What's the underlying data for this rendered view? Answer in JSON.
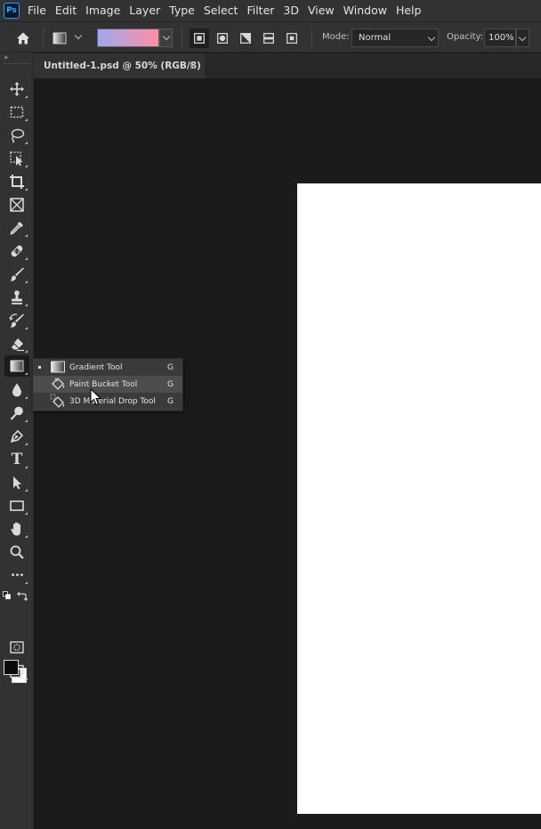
{
  "app": {
    "logo": "Ps"
  },
  "menubar": {
    "items": [
      "File",
      "Edit",
      "Image",
      "Layer",
      "Type",
      "Select",
      "Filter",
      "3D",
      "View",
      "Window",
      "Help"
    ]
  },
  "options": {
    "mode_label": "Mode:",
    "mode_value": "Normal",
    "opacity_label": "Opacity:",
    "opacity_value": "100%",
    "gradient_colors": [
      "#9fa8ee",
      "#fd8fa4"
    ],
    "gradient_types": [
      "linear-gradient-icon",
      "radial-gradient-icon",
      "angle-gradient-icon",
      "reflected-gradient-icon",
      "diamond-gradient-icon"
    ]
  },
  "document": {
    "tab_title": "Untitled-1.psd @ 50% (RGB/8)",
    "close_glyph": "×",
    "canvas_color": "#ffffff"
  },
  "toolbar": {
    "collapse_glyph": "»",
    "tools": [
      "move-tool",
      "marquee-tool",
      "lasso-tool",
      "object-selection-tool",
      "crop-tool",
      "frame-tool",
      "eyedropper-tool",
      "healing-brush-tool",
      "brush-tool",
      "clone-stamp-tool",
      "history-brush-tool",
      "eraser-tool",
      "gradient-tool",
      "blur-tool",
      "dodge-tool",
      "pen-tool",
      "type-tool",
      "path-selection-tool",
      "rectangle-tool",
      "hand-tool",
      "zoom-tool",
      "edit-toolbar",
      "default-colors",
      "swap-colors",
      "quick-mask",
      "screen-mode"
    ],
    "type_glyph": "T",
    "more_glyph": "•••",
    "foreground_color": "#0a0a0a",
    "background_color": "#ffffff"
  },
  "flyout": {
    "items": [
      {
        "label": "Gradient Tool",
        "shortcut": "G",
        "selected": true
      },
      {
        "label": "Paint Bucket Tool",
        "shortcut": "G",
        "hovered": true
      },
      {
        "label": "3D Material Drop Tool",
        "shortcut": "G"
      }
    ]
  }
}
